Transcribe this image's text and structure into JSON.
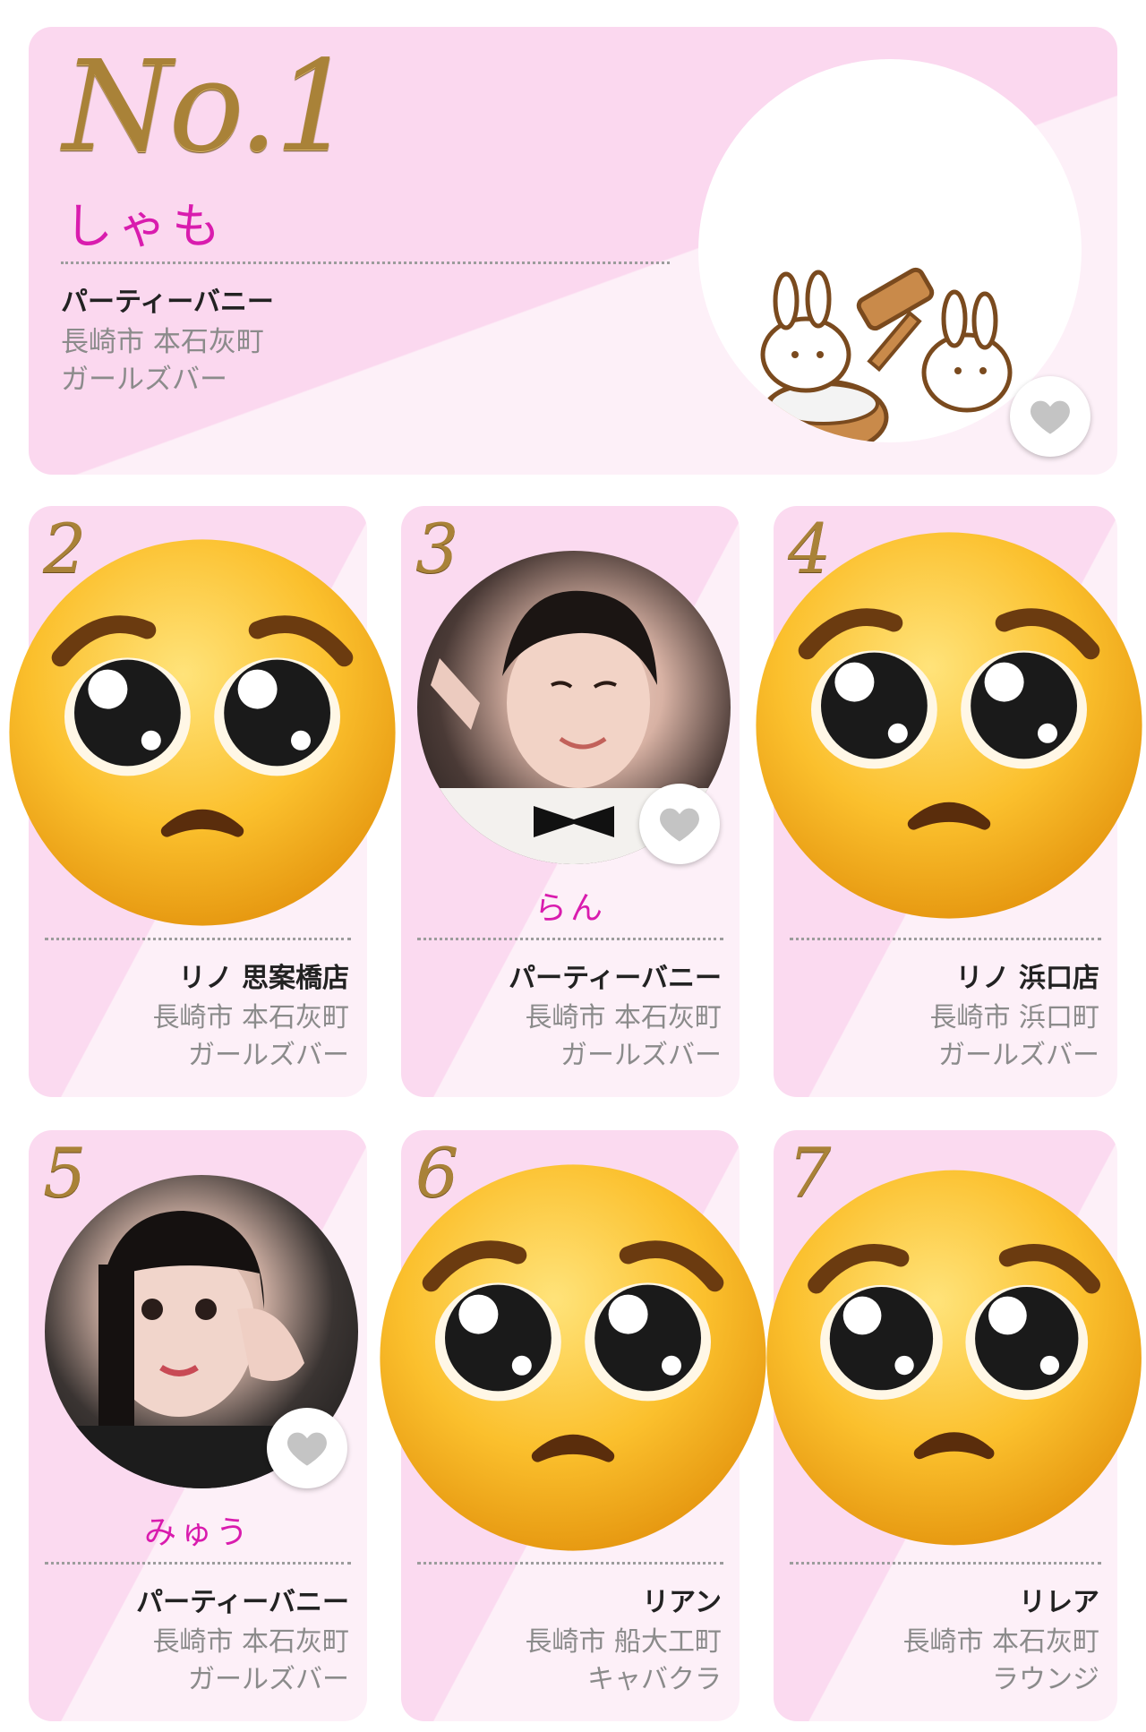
{
  "top": {
    "rank": "No.1",
    "name": "しゃも",
    "shop": "パーティーバニー",
    "address": "長崎市 本石灰町",
    "category": "ガールズバー"
  },
  "cards": [
    {
      "rank": "2",
      "name": "",
      "shop": "リノ 思案橋店",
      "address": "長崎市 本石灰町",
      "category": "ガールズバー"
    },
    {
      "rank": "3",
      "name": "らん",
      "shop": "パーティーバニー",
      "address": "長崎市 本石灰町",
      "category": "ガールズバー"
    },
    {
      "rank": "4",
      "name": "",
      "shop": "リノ 浜口店",
      "address": "長崎市 浜口町",
      "category": "ガールズバー"
    },
    {
      "rank": "5",
      "name": "みゅう",
      "shop": "パーティーバニー",
      "address": "長崎市 本石灰町",
      "category": "ガールズバー"
    },
    {
      "rank": "6",
      "name": "",
      "shop": "リアン",
      "address": "長崎市 船大工町",
      "category": "キャバクラ"
    },
    {
      "rank": "7",
      "name": "",
      "shop": "リレア",
      "address": "長崎市 本石灰町",
      "category": "ラウンジ"
    }
  ],
  "icons": {
    "favorite": "heart-icon",
    "cover": "pleading-face-emoji"
  },
  "colors": {
    "card_pink": "#fbdaf0",
    "name_magenta": "#d91cae",
    "gold": "#a98238",
    "heart_gray": "#c4c4c4"
  }
}
